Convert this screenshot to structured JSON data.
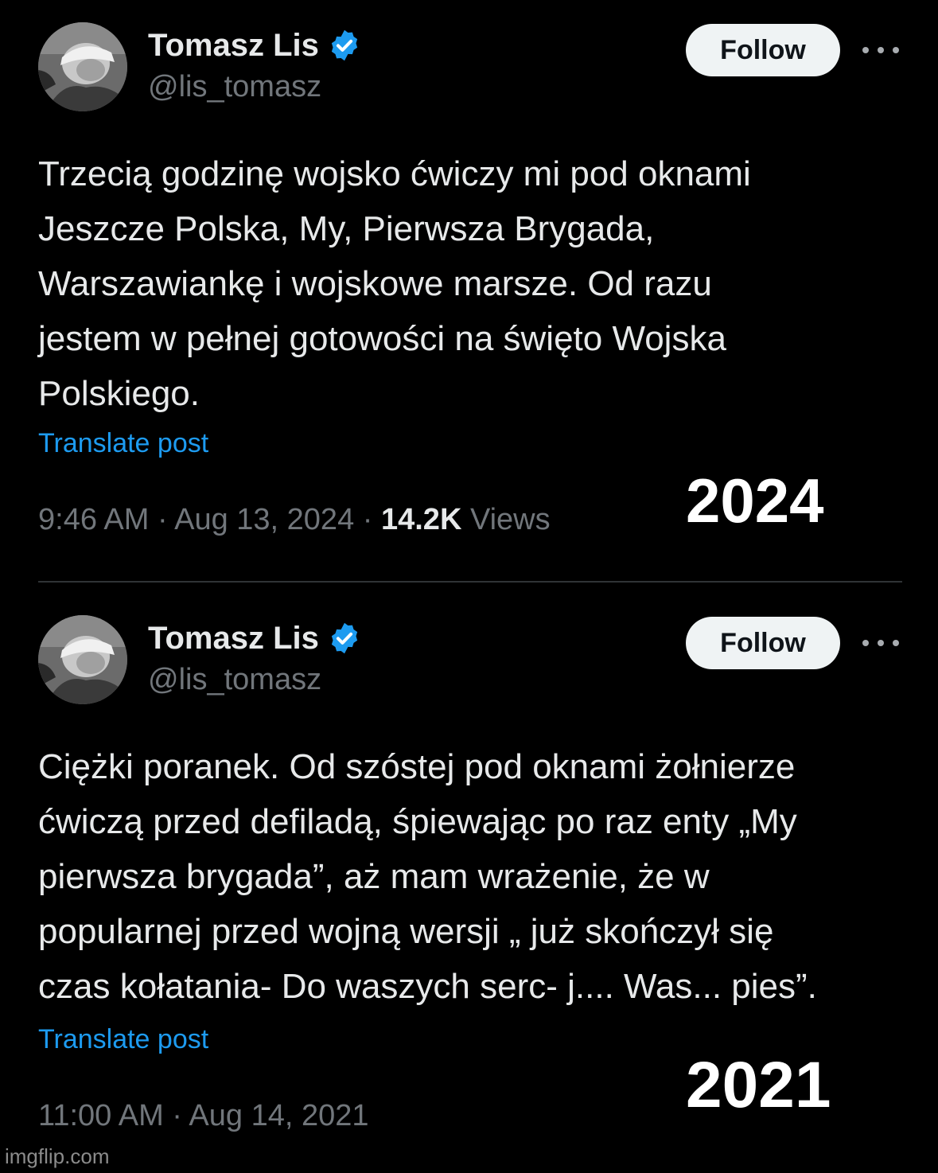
{
  "tweets": [
    {
      "author": {
        "name": "Tomasz Lis",
        "handle": "@lis_tomasz",
        "verified_icon": "verified-badge-icon",
        "avatar": "profile-photo"
      },
      "follow_label": "Follow",
      "more_icon": "more-options-icon",
      "text_lines": [
        "Trzecią godzinę wojsko ćwiczy mi pod oknami",
        "Jeszcze Polska, My, Pierwsza Brygada,",
        "Warszawiankę i wojskowe marsze. Od razu",
        "jestem w pełnej gotowości na święto Wojska",
        "Polskiego."
      ],
      "translate_label": "Translate post",
      "time": "9:46 AM",
      "date": "Aug 13, 2024",
      "separator": " · ",
      "views_count": "14.2K",
      "views_label": " Views",
      "year_overlay": "2024"
    },
    {
      "author": {
        "name": "Tomasz Lis",
        "handle": "@lis_tomasz",
        "verified_icon": "verified-badge-icon",
        "avatar": "profile-photo"
      },
      "follow_label": "Follow",
      "more_icon": "more-options-icon",
      "text_lines": [
        "Ciężki poranek. Od szóstej pod oknami żołnierze",
        "ćwiczą przed defiladą, śpiewając po raz enty „My",
        "pierwsza brygada”, aż mam wrażenie, że w",
        "popularnej przed wojną wersji „ już skończył  się",
        "czas kołatania- Do waszych serc- j.... Was... pies”."
      ],
      "translate_label": "Translate post",
      "time": "11:00 AM",
      "date": "Aug 14, 2021",
      "separator": " · ",
      "year_overlay": "2021"
    }
  ],
  "watermark": "imgflip.com",
  "colors": {
    "background": "#000000",
    "text_primary": "#e7e9ea",
    "text_secondary": "#71767b",
    "link": "#1d9bf0",
    "verified": "#1d9bf0",
    "follow_bg": "#eff3f4",
    "divider": "#2f3336"
  }
}
